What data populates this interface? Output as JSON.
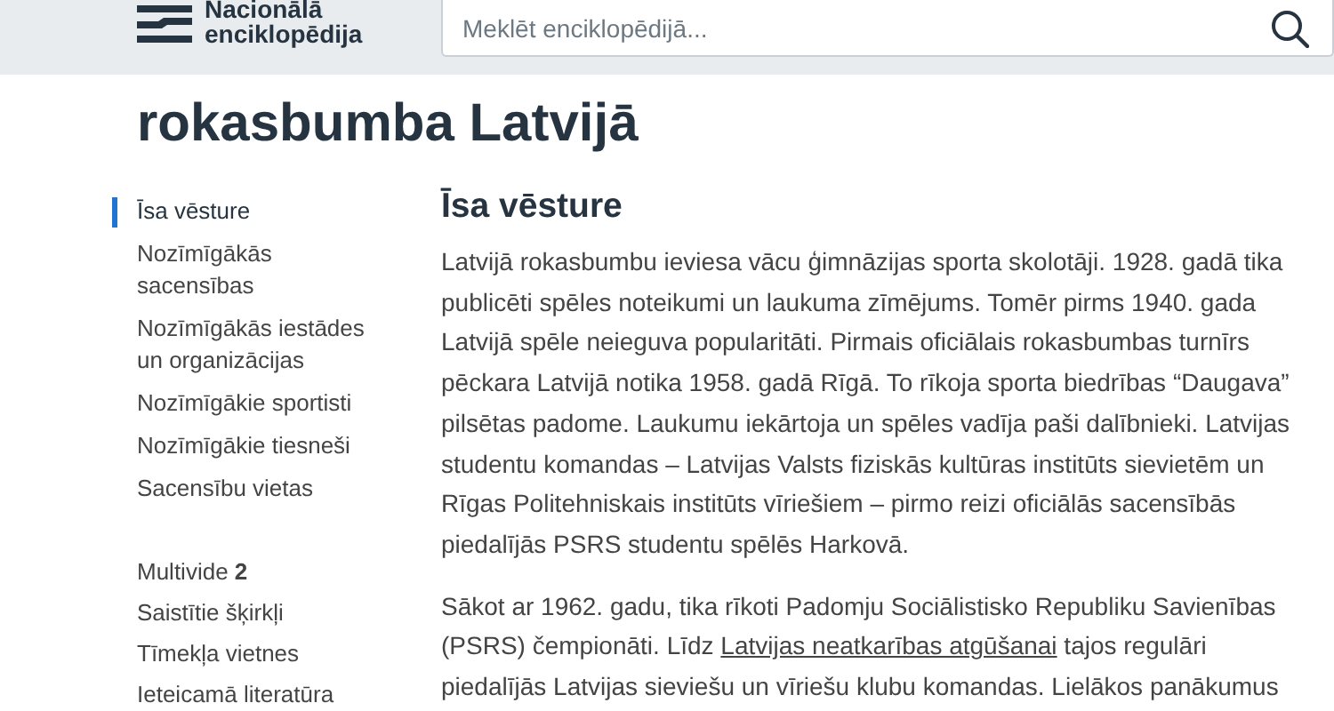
{
  "header": {
    "logo_lines": [
      "Nacionālā",
      "enciklopēdija"
    ],
    "search": {
      "placeholder": "Meklēt enciklopēdijā..."
    }
  },
  "title": "rokasbumba Latvijā",
  "toc": [
    {
      "label": "Īsa vēsture",
      "selected": true
    },
    {
      "label": "Nozīmīgākās sacensības",
      "selected": false
    },
    {
      "label": "Nozīmīgākās iestādes un organizācijas",
      "selected": false
    },
    {
      "label": "Nozīmīgākie sportisti",
      "selected": false
    },
    {
      "label": "Nozīmīgākie tiesneši",
      "selected": false
    },
    {
      "label": "Sacensību vietas",
      "selected": false
    }
  ],
  "extras": [
    {
      "label": "Multivide **2**"
    },
    {
      "label": "Saistītie šķirkļi"
    },
    {
      "label": "Tīmekļa vietnes"
    },
    {
      "label": "Ieteicamā literatūra"
    }
  ],
  "section": {
    "heading": "Īsa vēsture",
    "paragraphs": [
      {
        "text": "Latvijā rokasbumbu ieviesa vācu ģimnāzijas sporta skolotāji. 1928. gadā tika publicēti spēles noteikumi un laukuma zīmējums. Tomēr pirms 1940. gada Latvijā spēle neieguva popularitāti. Pirmais oficiālais rokasbumbas turnīrs pēckara Latvijā notika 1958. gadā Rīgā. To rīkoja sporta biedrības “Daugava” pilsētas padome. Laukumu iekārtoja un spēles vadīja paši dalībnieki. Latvijas studentu komandas – Latvijas Valsts fiziskās kultūras institūts sievietēm un Rīgas Politehniskais institūts vīriešiem – pirmo reizi oficiālās sacensībās piedalījās PSRS studentu spēlēs Harkovā."
      },
      {
        "text": "Sākot ar 1962. gadu, tika rīkoti Padomju Sociālistisko Republiku Savienības (PSRS) čempionāti. Līdz ",
        "link": "Latvijas neatkarības atgūšanai",
        "text_after": " tajos regulāri piedalījās Latvijas sieviešu un vīriešu klubu komandas. Lielākos panākumus"
      }
    ]
  }
}
